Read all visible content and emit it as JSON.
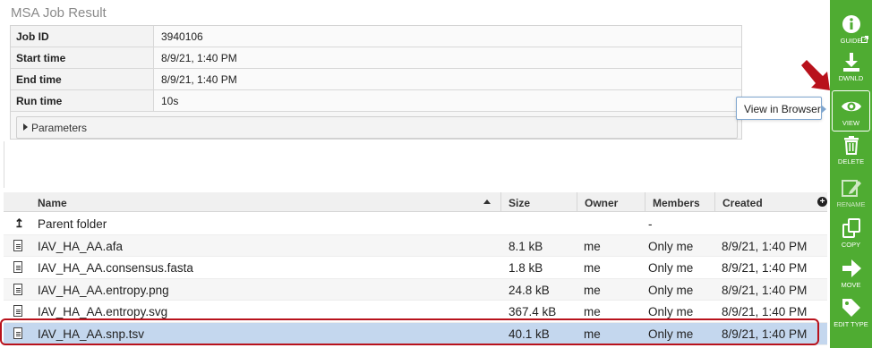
{
  "header": {
    "title": "MSA Job Result"
  },
  "summary": {
    "rows": [
      {
        "label": "Job ID",
        "value": "3940106"
      },
      {
        "label": "Start time",
        "value": "8/9/21, 1:40 PM"
      },
      {
        "label": "End time",
        "value": "8/9/21, 1:40 PM"
      },
      {
        "label": "Run time",
        "value": "10s"
      }
    ],
    "parameters_label": "Parameters"
  },
  "table": {
    "columns": [
      "Name",
      "Size",
      "Owner",
      "Members",
      "Created"
    ],
    "rows": [
      {
        "icon": "parent-folder-icon",
        "name": "Parent folder",
        "size": "",
        "owner": "",
        "members": "-",
        "created": ""
      },
      {
        "icon": "file-icon",
        "name": "IAV_HA_AA.afa",
        "size": "8.1 kB",
        "owner": "me",
        "members": "Only me",
        "created": "8/9/21, 1:40 PM"
      },
      {
        "icon": "file-icon",
        "name": "IAV_HA_AA.consensus.fasta",
        "size": "1.8 kB",
        "owner": "me",
        "members": "Only me",
        "created": "8/9/21, 1:40 PM"
      },
      {
        "icon": "file-icon",
        "name": "IAV_HA_AA.entropy.png",
        "size": "24.8 kB",
        "owner": "me",
        "members": "Only me",
        "created": "8/9/21, 1:40 PM"
      },
      {
        "icon": "file-icon",
        "name": "IAV_HA_AA.entropy.svg",
        "size": "367.4 kB",
        "owner": "me",
        "members": "Only me",
        "created": "8/9/21, 1:40 PM"
      },
      {
        "icon": "file-icon",
        "name": "IAV_HA_AA.snp.tsv",
        "size": "40.1 kB",
        "owner": "me",
        "members": "Only me",
        "created": "8/9/21, 1:40 PM",
        "selected": true
      }
    ]
  },
  "tooltip": {
    "text": "View in Browser"
  },
  "sidebar": {
    "actions": [
      {
        "label": "GUIDE",
        "icon": "info-icon"
      },
      {
        "label": "DWNLD",
        "icon": "download-icon"
      },
      {
        "label": "VIEW",
        "icon": "eye-icon",
        "active": true
      },
      {
        "label": "DELETE",
        "icon": "trash-icon"
      },
      {
        "label": "RENAME",
        "icon": "pencil-icon",
        "disabled": true
      },
      {
        "label": "COPY",
        "icon": "copy-icon"
      },
      {
        "label": "MOVE",
        "icon": "arrow-right-icon"
      },
      {
        "label": "EDIT TYPE",
        "icon": "tag-icon"
      }
    ]
  },
  "colors": {
    "sidebar_green": "#4fac32",
    "selected_row": "#c4d7ee",
    "highlight_red": "#b8121c"
  }
}
